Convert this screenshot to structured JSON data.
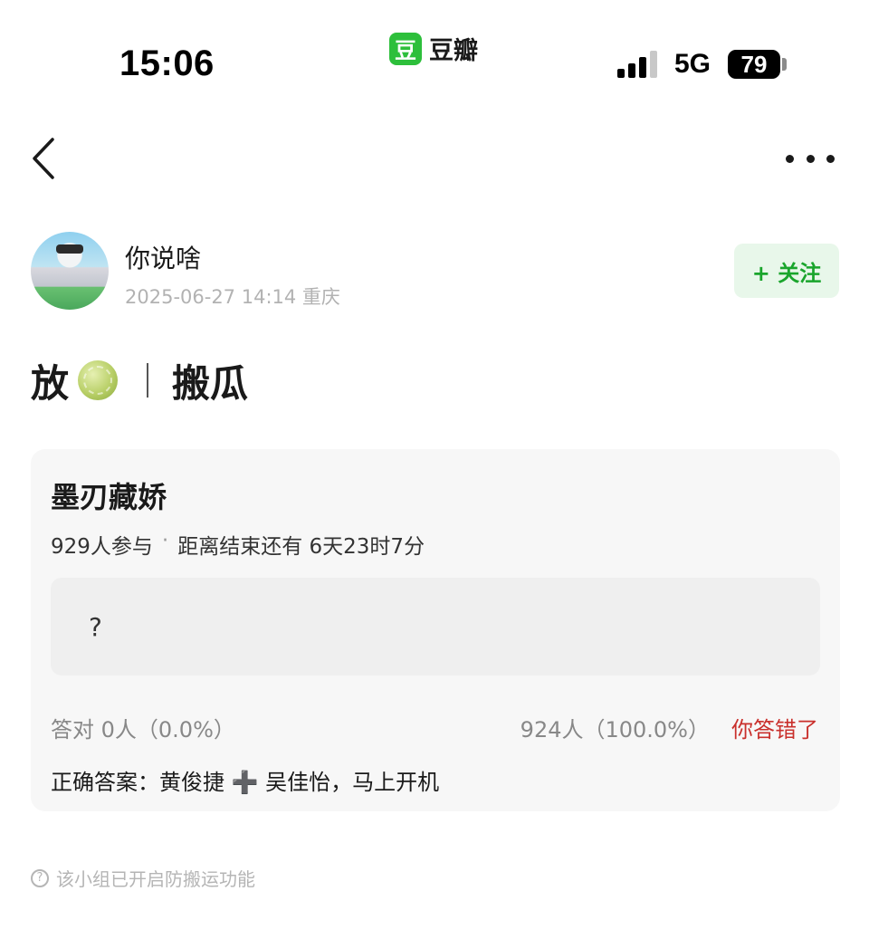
{
  "status_bar": {
    "time": "15:06",
    "app_badge_icon_text": "豆",
    "app_name": "豆瓣",
    "network": "5G",
    "battery": "79",
    "icons": [
      "signal-icon",
      "battery-icon"
    ]
  },
  "nav": {
    "icons": [
      "back-icon",
      "more-icon"
    ]
  },
  "author": {
    "name": "你说啥",
    "meta": "2025-06-27 14:14  重庆",
    "follow_label": "+ 关注"
  },
  "post": {
    "title_prefix": "放",
    "title_icon": "melon-icon",
    "title_suffix": "搬瓜"
  },
  "quiz": {
    "title": "墨刃藏娇",
    "participants": "929人参与",
    "countdown": "距离结束还有 6天23时7分",
    "option_text": "?",
    "correct_count_label": "答对  0人（0.0%）",
    "answer_count": "924人（100.0%）",
    "wrong_label": "你答错了",
    "correct_answer": "正确答案：黄俊捷 ➕ 吴佳怡，马上开机"
  },
  "footer": {
    "note": "该小组已开启防搬运功能",
    "icon": "question-circle-icon"
  },
  "colors": {
    "accent_green": "#1aa52c",
    "follow_bg": "#e8f7ea",
    "wrong_red": "#c9302c",
    "card_bg": "#f7f7f7"
  }
}
